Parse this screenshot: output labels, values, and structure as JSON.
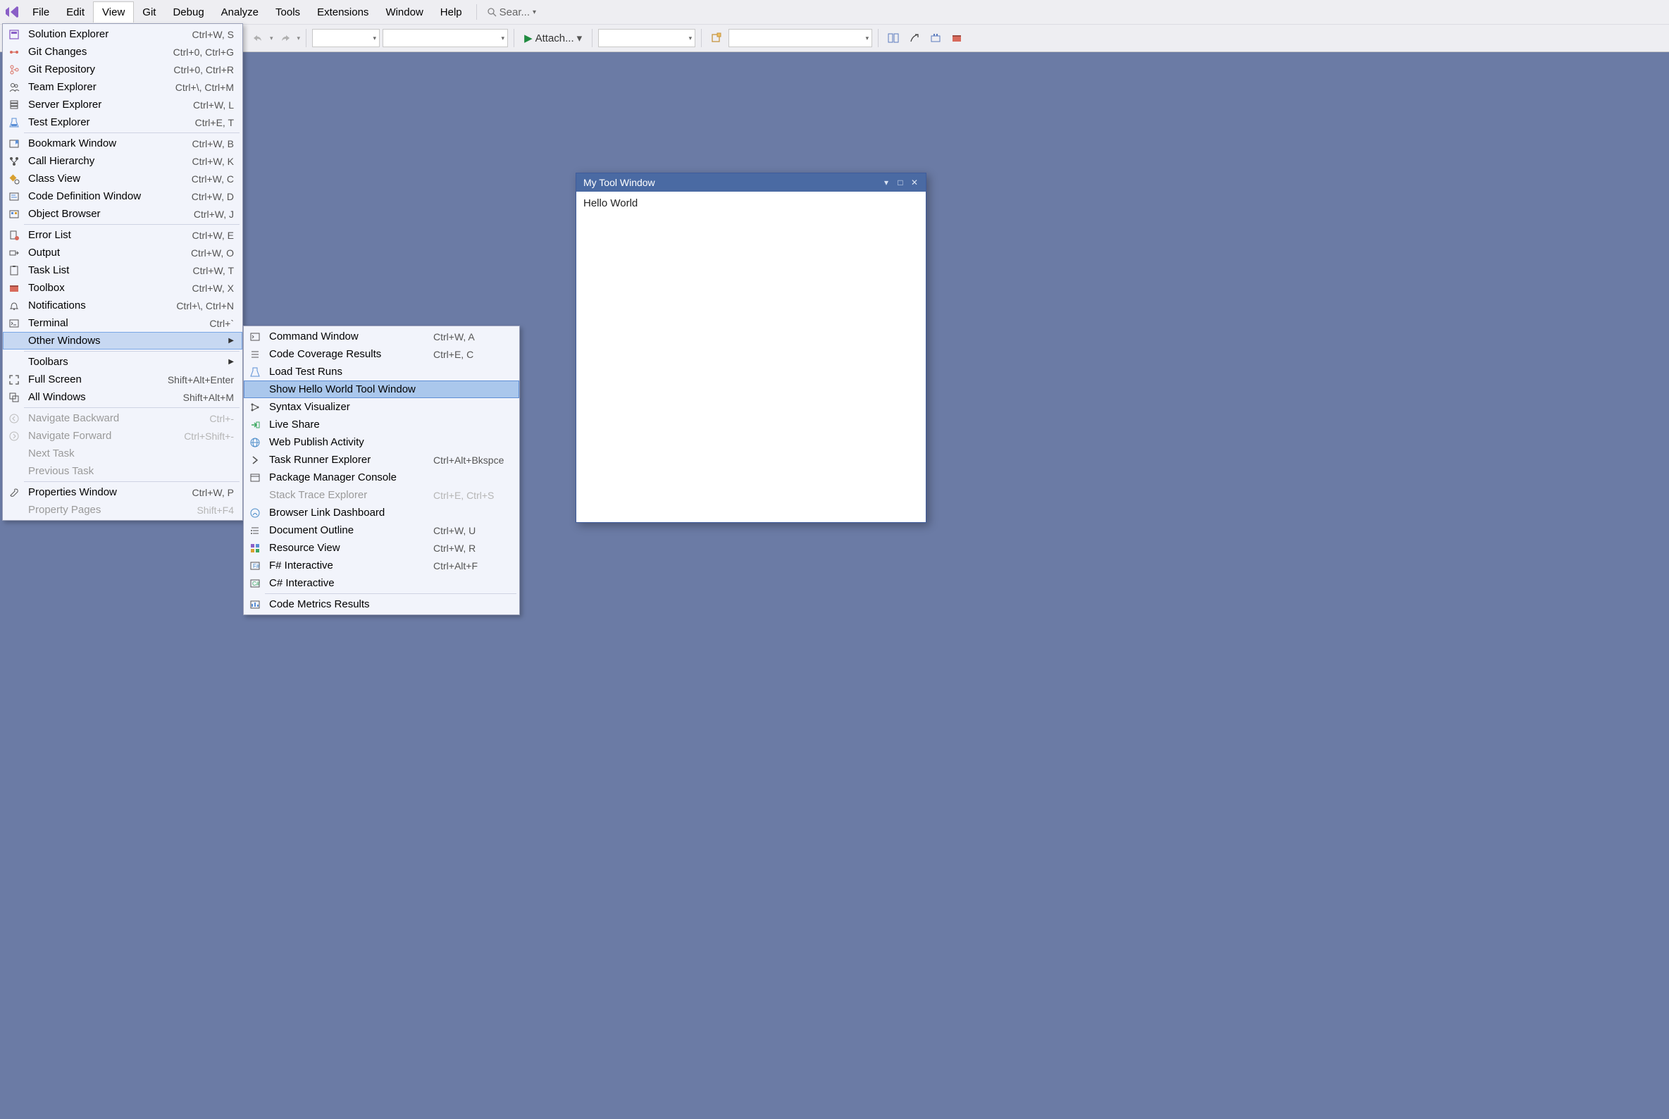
{
  "menubar": {
    "items": [
      "File",
      "Edit",
      "View",
      "Git",
      "Debug",
      "Analyze",
      "Tools",
      "Extensions",
      "Window",
      "Help"
    ],
    "search_placeholder": "Sear..."
  },
  "toolbar": {
    "attach_label": "Attach..."
  },
  "view_menu": {
    "g1": [
      {
        "icon": "solution",
        "label": "Solution Explorer",
        "shortcut": "Ctrl+W, S"
      },
      {
        "icon": "gitchanges",
        "label": "Git Changes",
        "shortcut": "Ctrl+0, Ctrl+G"
      },
      {
        "icon": "gitrepo",
        "label": "Git Repository",
        "shortcut": "Ctrl+0, Ctrl+R"
      },
      {
        "icon": "team",
        "label": "Team Explorer",
        "shortcut": "Ctrl+\\, Ctrl+M"
      },
      {
        "icon": "server",
        "label": "Server Explorer",
        "shortcut": "Ctrl+W, L"
      },
      {
        "icon": "test",
        "label": "Test Explorer",
        "shortcut": "Ctrl+E, T"
      }
    ],
    "g2": [
      {
        "icon": "bookmark",
        "label": "Bookmark Window",
        "shortcut": "Ctrl+W, B"
      },
      {
        "icon": "callh",
        "label": "Call Hierarchy",
        "shortcut": "Ctrl+W, K"
      },
      {
        "icon": "classv",
        "label": "Class View",
        "shortcut": "Ctrl+W, C"
      },
      {
        "icon": "codedef",
        "label": "Code Definition Window",
        "shortcut": "Ctrl+W, D"
      },
      {
        "icon": "objbrowser",
        "label": "Object Browser",
        "shortcut": "Ctrl+W, J"
      }
    ],
    "g3": [
      {
        "icon": "errlist",
        "label": "Error List",
        "shortcut": "Ctrl+W, E"
      },
      {
        "icon": "output",
        "label": "Output",
        "shortcut": "Ctrl+W, O"
      },
      {
        "icon": "tasklist",
        "label": "Task List",
        "shortcut": "Ctrl+W, T"
      },
      {
        "icon": "toolbox",
        "label": "Toolbox",
        "shortcut": "Ctrl+W, X"
      },
      {
        "icon": "notif",
        "label": "Notifications",
        "shortcut": "Ctrl+\\, Ctrl+N"
      },
      {
        "icon": "terminal",
        "label": "Terminal",
        "shortcut": "Ctrl+`"
      }
    ],
    "other_windows_label": "Other Windows",
    "toolbars_label": "Toolbars",
    "g5": [
      {
        "icon": "fullscreen",
        "label": "Full Screen",
        "shortcut": "Shift+Alt+Enter"
      },
      {
        "icon": "allwin",
        "label": "All Windows",
        "shortcut": "Shift+Alt+M"
      }
    ],
    "g6": [
      {
        "icon": "navback",
        "label": "Navigate Backward",
        "shortcut": "Ctrl+-",
        "disabled": true
      },
      {
        "icon": "navfwd",
        "label": "Navigate Forward",
        "shortcut": "Ctrl+Shift+-",
        "disabled": true
      },
      {
        "icon": "",
        "label": "Next Task",
        "shortcut": "",
        "disabled": true
      },
      {
        "icon": "",
        "label": "Previous Task",
        "shortcut": "",
        "disabled": true
      }
    ],
    "g7": [
      {
        "icon": "props",
        "label": "Properties Window",
        "shortcut": "Ctrl+W, P"
      },
      {
        "icon": "",
        "label": "Property Pages",
        "shortcut": "Shift+F4",
        "disabled": true
      }
    ]
  },
  "other_menu": {
    "items": [
      {
        "icon": "cmdwin",
        "label": "Command Window",
        "shortcut": "Ctrl+W, A"
      },
      {
        "icon": "codecov",
        "label": "Code Coverage Results",
        "shortcut": "Ctrl+E, C"
      },
      {
        "icon": "loadtest",
        "label": "Load Test Runs",
        "shortcut": ""
      },
      {
        "icon": "",
        "label": "Show Hello World Tool Window",
        "shortcut": "",
        "selected": true
      },
      {
        "icon": "syntax",
        "label": "Syntax Visualizer",
        "shortcut": ""
      },
      {
        "icon": "liveshare",
        "label": "Live Share",
        "shortcut": ""
      },
      {
        "icon": "webpub",
        "label": "Web Publish Activity",
        "shortcut": ""
      },
      {
        "icon": "taskrun",
        "label": "Task Runner Explorer",
        "shortcut": "Ctrl+Alt+Bkspce"
      },
      {
        "icon": "pkgmgr",
        "label": "Package Manager Console",
        "shortcut": ""
      },
      {
        "icon": "",
        "label": "Stack Trace Explorer",
        "shortcut": "Ctrl+E, Ctrl+S",
        "disabled": true
      },
      {
        "icon": "browserlink",
        "label": "Browser Link Dashboard",
        "shortcut": ""
      },
      {
        "icon": "docoutline",
        "label": "Document Outline",
        "shortcut": "Ctrl+W, U"
      },
      {
        "icon": "resview",
        "label": "Resource View",
        "shortcut": "Ctrl+W, R"
      },
      {
        "icon": "fsharp",
        "label": "F# Interactive",
        "shortcut": "Ctrl+Alt+F"
      },
      {
        "icon": "csharp",
        "label": "C# Interactive",
        "shortcut": ""
      },
      {
        "icon": "codemetrics",
        "label": "Code Metrics Results",
        "shortcut": ""
      }
    ]
  },
  "tool_window": {
    "title": "My Tool Window",
    "content": "Hello World"
  }
}
